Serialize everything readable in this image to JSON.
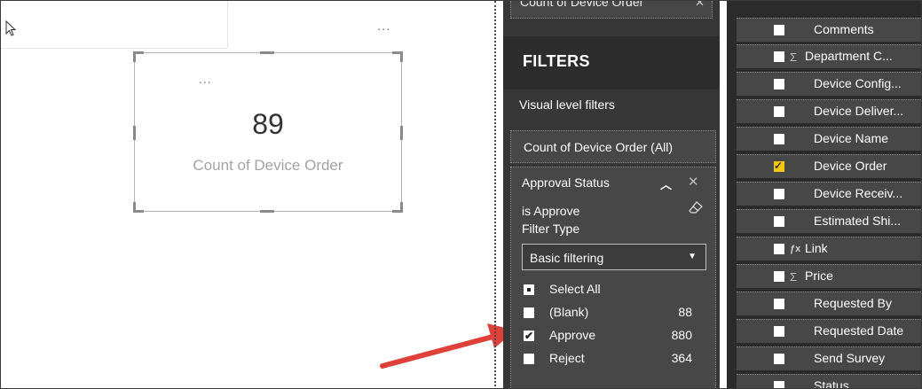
{
  "canvas": {
    "card": {
      "value": "89",
      "label": "Count of Device Order"
    }
  },
  "filters": {
    "top_well_label": "Count of Device Order",
    "title": "FILTERS",
    "section_label": "Visual level filters",
    "count_filter": "Count of Device Order (All)",
    "approval": {
      "title": "Approval Status",
      "condition": "is Approve",
      "filter_type_label": "Filter Type",
      "filter_type_value": "Basic filtering",
      "options": [
        {
          "label": "Select All",
          "count": "",
          "state": "partial"
        },
        {
          "label": "(Blank)",
          "count": "88",
          "state": "unchecked"
        },
        {
          "label": "Approve",
          "count": "880",
          "state": "checked"
        },
        {
          "label": "Reject",
          "count": "364",
          "state": "unchecked"
        }
      ]
    }
  },
  "fields": [
    {
      "name": "Comments",
      "type": "",
      "checked": false
    },
    {
      "name": "Department C...",
      "type": "Σ",
      "checked": false
    },
    {
      "name": "Device Config...",
      "type": "",
      "checked": false
    },
    {
      "name": "Device Deliver...",
      "type": "",
      "checked": false
    },
    {
      "name": "Device Name",
      "type": "",
      "checked": false
    },
    {
      "name": "Device Order",
      "type": "",
      "checked": true
    },
    {
      "name": "Device Receiv...",
      "type": "",
      "checked": false
    },
    {
      "name": "Estimated Shi...",
      "type": "",
      "checked": false
    },
    {
      "name": "Link",
      "type": "fx",
      "checked": false
    },
    {
      "name": "Price",
      "type": "Σ",
      "checked": false
    },
    {
      "name": "Requested By",
      "type": "",
      "checked": false
    },
    {
      "name": "Requested Date",
      "type": "",
      "checked": false
    },
    {
      "name": "Send Survey",
      "type": "",
      "checked": false
    },
    {
      "name": "Status",
      "type": "",
      "checked": false
    }
  ],
  "colors": {
    "accent_check": "#f2c811",
    "pane_dark": "#373737",
    "arrow": "#e0403a"
  },
  "icons": [
    "cursor-icon",
    "more-options-icon",
    "chevron-up-icon",
    "close-icon",
    "eraser-icon",
    "dropdown-arrow-icon",
    "sigma-icon",
    "calculated-column-icon"
  ]
}
